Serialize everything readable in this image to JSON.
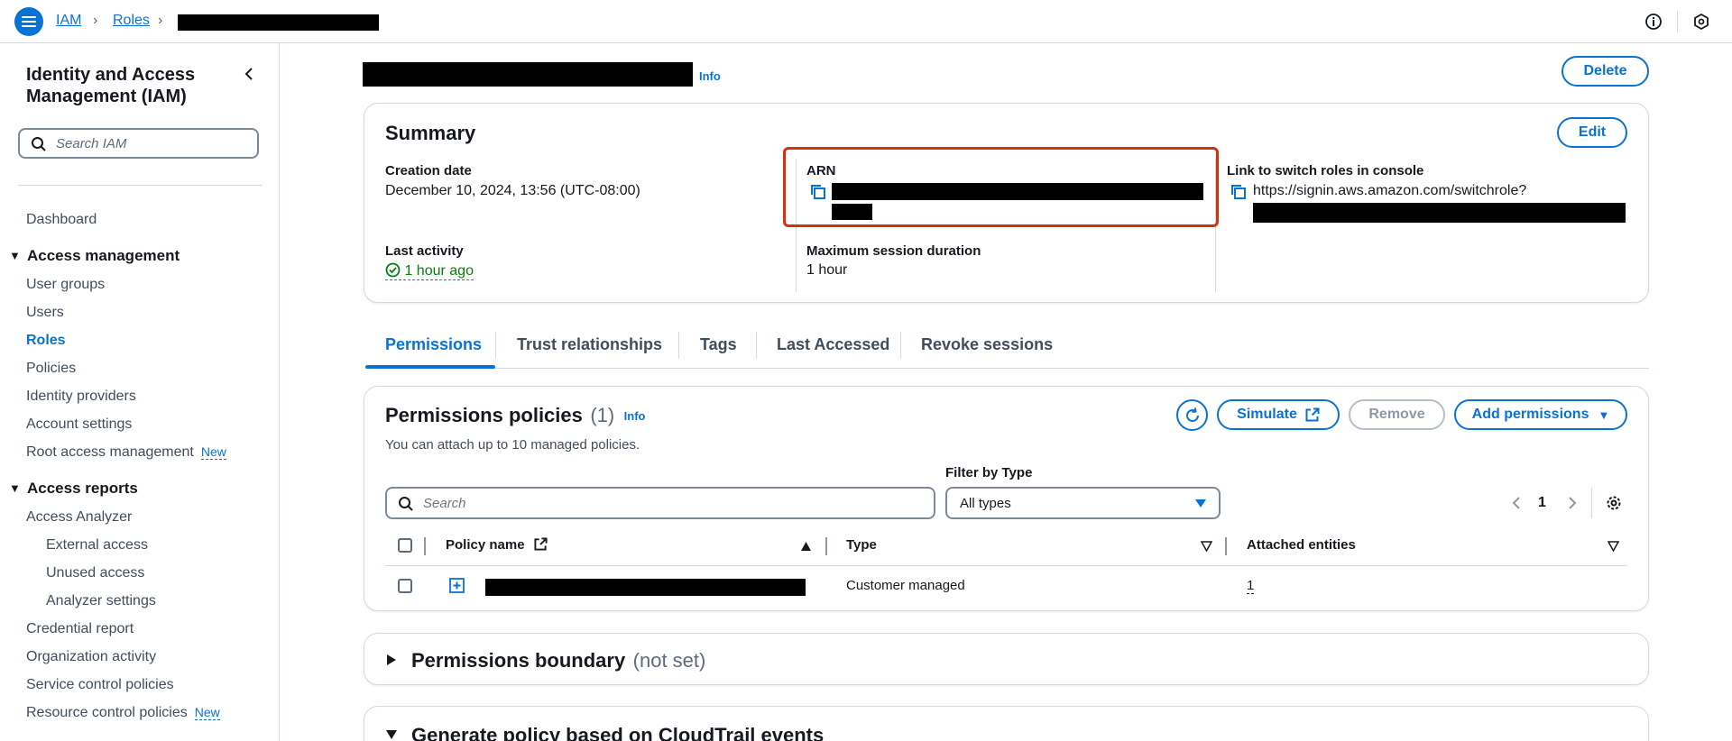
{
  "breadcrumb": {
    "items": [
      "IAM",
      "Roles"
    ]
  },
  "sidebar": {
    "title": "Identity and Access Management (IAM)",
    "search_placeholder": "Search IAM",
    "dashboard": "Dashboard",
    "sections": [
      {
        "label": "Access management",
        "items": [
          "User groups",
          "Users",
          "Roles",
          "Policies",
          "Identity providers",
          "Account settings",
          "Root access management"
        ]
      },
      {
        "label": "Access reports",
        "items": [
          "Access Analyzer",
          "External access",
          "Unused access",
          "Analyzer settings",
          "Credential report",
          "Organization activity",
          "Service control policies",
          "Resource control policies"
        ]
      }
    ],
    "new_badge": "New",
    "active_item": "Roles"
  },
  "header": {
    "info": "Info",
    "delete_label": "Delete"
  },
  "summary": {
    "title": "Summary",
    "edit_label": "Edit",
    "creation_date_label": "Creation date",
    "creation_date_value": "December 10, 2024, 13:56 (UTC-08:00)",
    "arn_label": "ARN",
    "switch_label": "Link to switch roles in console",
    "switch_value": "https://signin.aws.amazon.com/switchrole?",
    "last_activity_label": "Last activity",
    "last_activity_value": "1 hour ago",
    "max_session_label": "Maximum session duration",
    "max_session_value": "1 hour"
  },
  "tabs": [
    "Permissions",
    "Trust relationships",
    "Tags",
    "Last Accessed",
    "Revoke sessions"
  ],
  "permissions": {
    "title": "Permissions policies",
    "count": "(1)",
    "info": "Info",
    "description": "You can attach up to 10 managed policies.",
    "simulate_label": "Simulate",
    "remove_label": "Remove",
    "add_label": "Add permissions",
    "filter_label": "Filter by Type",
    "search_placeholder": "Search",
    "filter_value": "All types",
    "page": "1",
    "columns": [
      "Policy name",
      "Type",
      "Attached entities"
    ],
    "rows": [
      {
        "type": "Customer managed",
        "attached": "1"
      }
    ]
  },
  "boundary": {
    "title": "Permissions boundary",
    "status": "(not set)"
  },
  "generate": {
    "title": "Generate policy based on CloudTrail events"
  },
  "colors": {
    "accent": "#0972d3",
    "success": "#037f0c",
    "highlight": "#d13212",
    "redaction": "#000000"
  }
}
